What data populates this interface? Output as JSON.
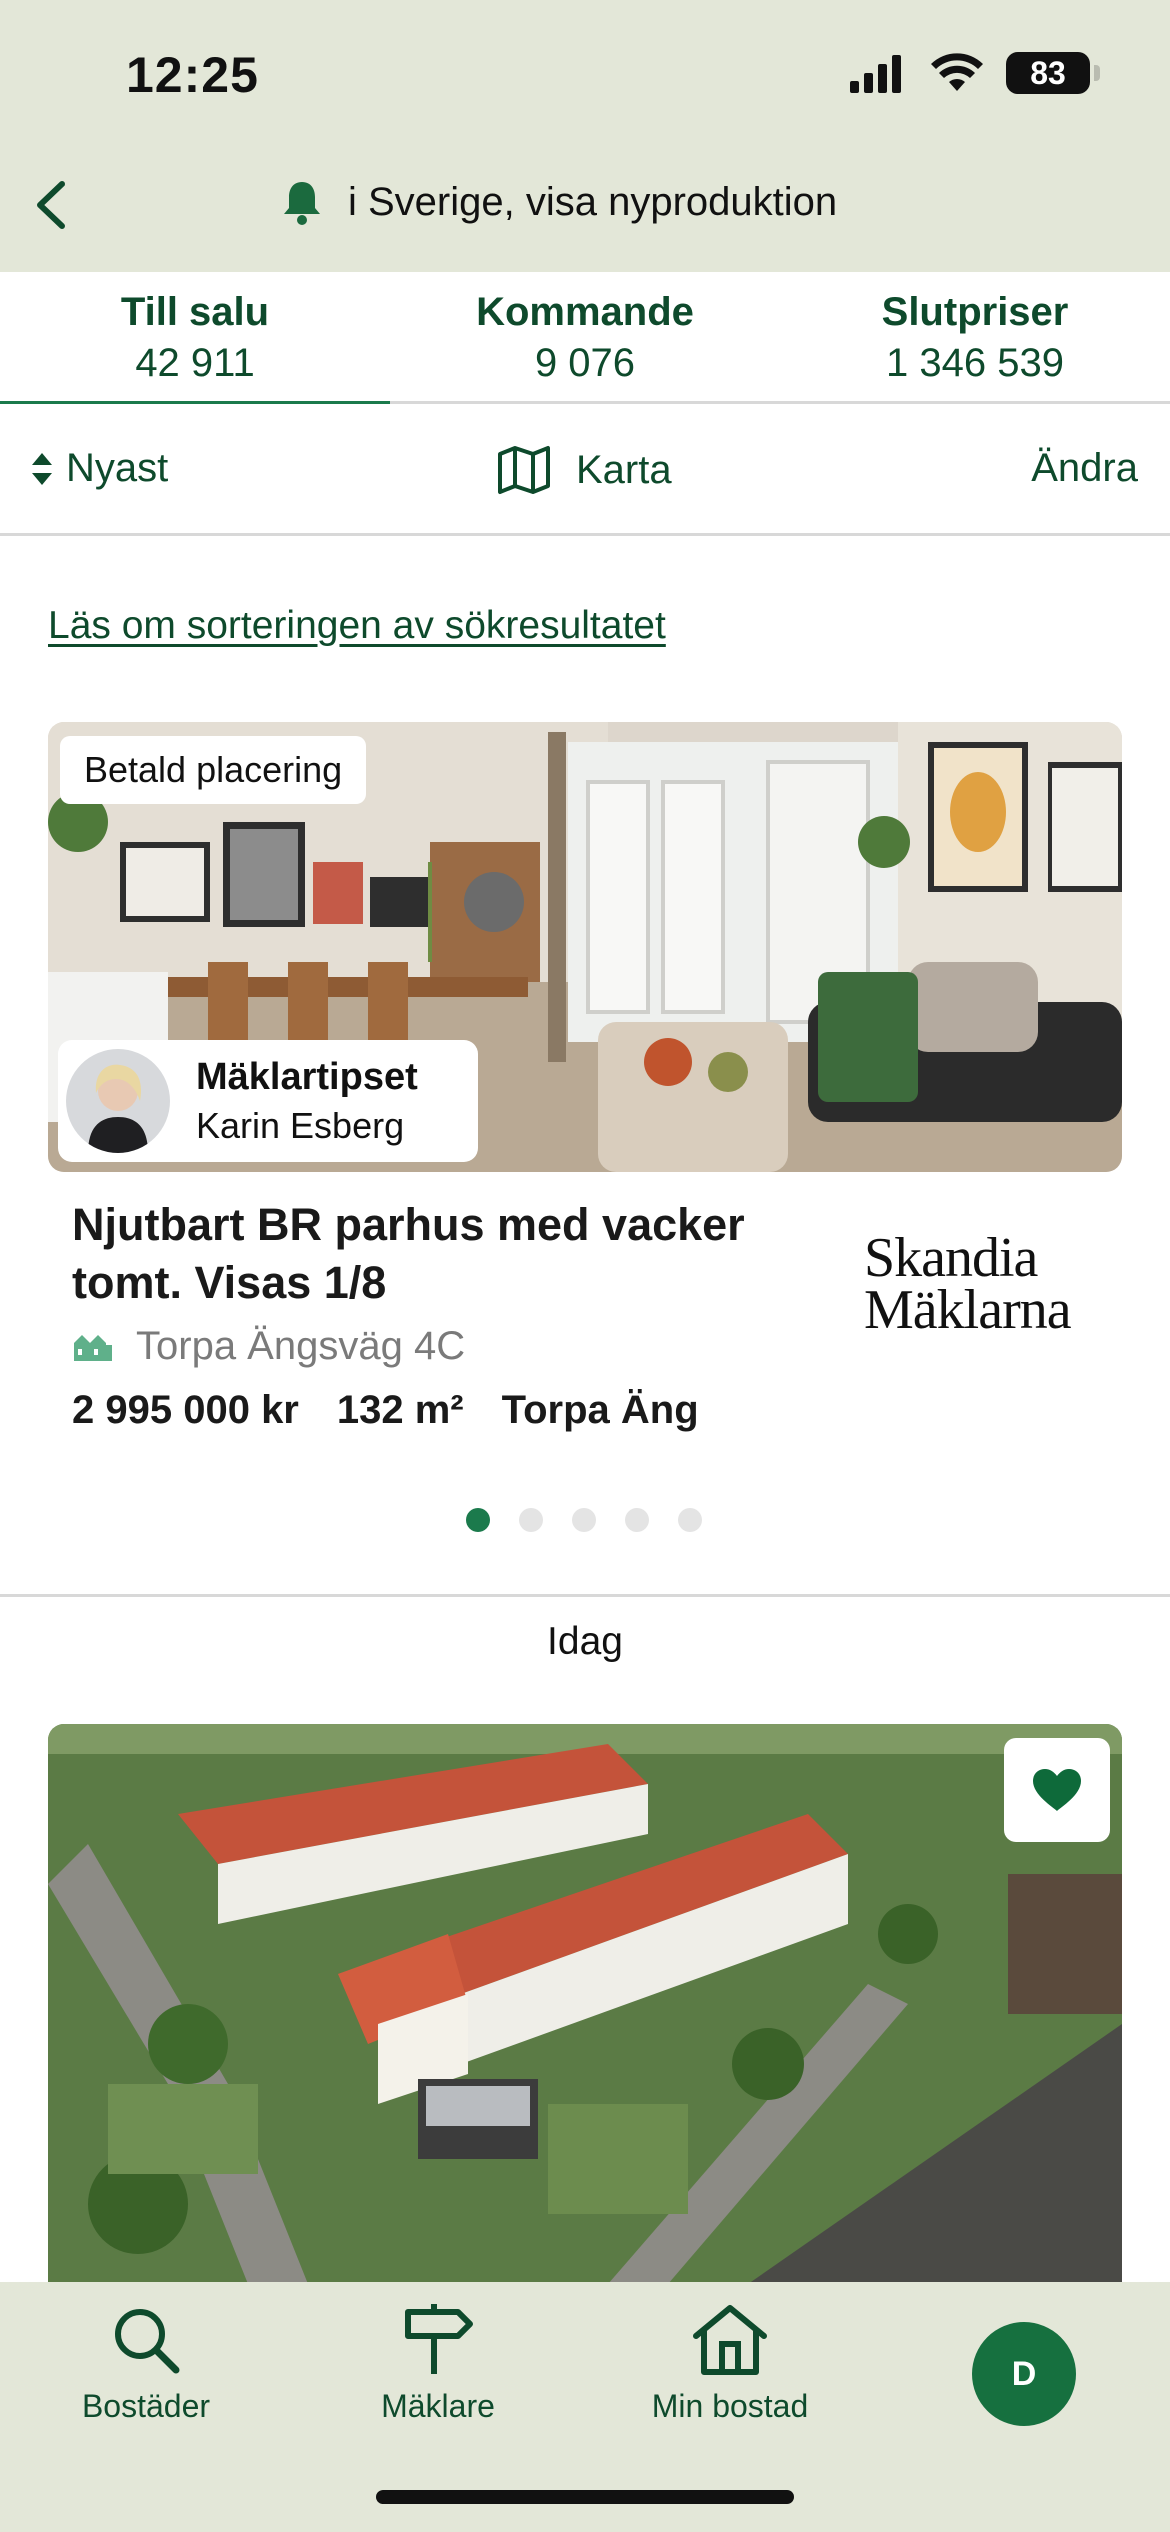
{
  "status_bar": {
    "time": "12:25",
    "battery": "83"
  },
  "header": {
    "search_text": "i Sverige, visa nyproduktion"
  },
  "tabs": [
    {
      "label": "Till salu",
      "count": "42 911"
    },
    {
      "label": "Kommande",
      "count": "9 076"
    },
    {
      "label": "Slutpriser",
      "count": "1 346 539"
    }
  ],
  "toolbar": {
    "sort_label": "Nyast",
    "map_label": "Karta",
    "edit_label": "Ändra"
  },
  "sort_info_link": "Läs om sorteringen av sökresultatet",
  "featured_listing": {
    "badge": "Betald placering",
    "agent_title": "Mäklartipset",
    "agent_name": "Karin Esberg",
    "title": "Njutbart BR parhus med vacker tomt. Visas 1/8",
    "address": "Torpa Ängsväg 4C",
    "price": "2 995 000 kr",
    "area": "132 m²",
    "district": "Torpa Äng",
    "broker_line1": "Skandia",
    "broker_line2": "Mäklarna"
  },
  "day_label": "Idag",
  "bottom_nav": [
    {
      "label": "Bostäder",
      "icon": "search-icon"
    },
    {
      "label": "Mäklare",
      "icon": "signpost-icon"
    },
    {
      "label": "Min bostad",
      "icon": "home-icon"
    }
  ],
  "profile_initial": "D",
  "colors": {
    "brand_green": "#0e4a2c",
    "accent_green": "#1b7a4c",
    "header_bg": "#e3e7d8"
  }
}
